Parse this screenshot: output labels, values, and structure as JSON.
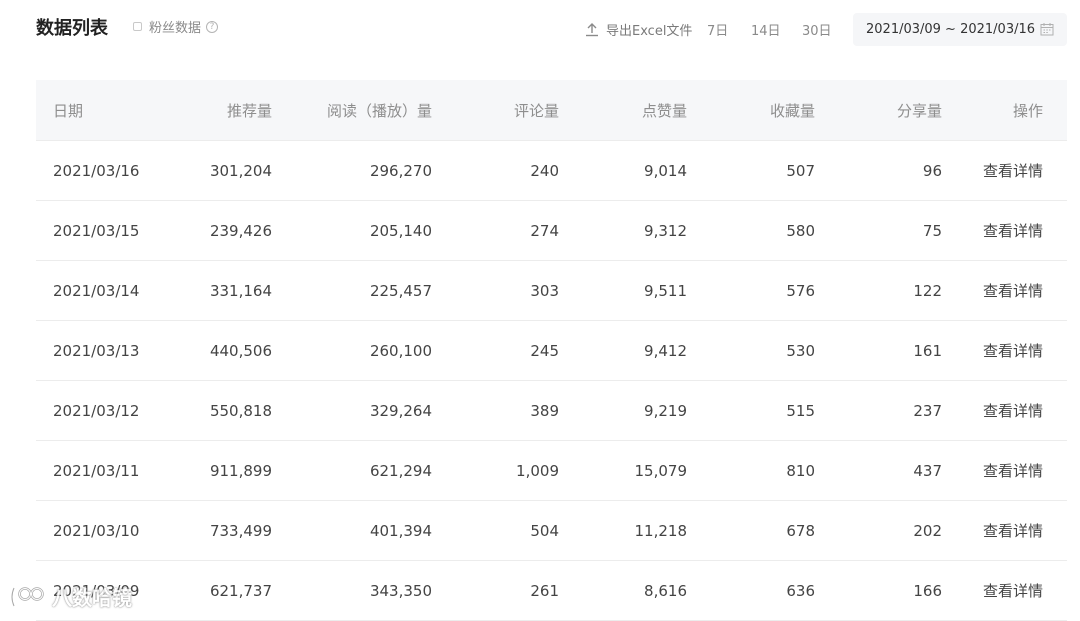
{
  "header": {
    "title": "数据列表",
    "fans_toggle_label": "粉丝数据",
    "help_symbol": "?",
    "export_label": "导出Excel文件",
    "ranges": [
      "7日",
      "14日",
      "30日"
    ],
    "date_range": "2021/03/09 ~ 2021/03/16"
  },
  "table": {
    "columns": [
      "日期",
      "推荐量",
      "阅读（播放）量",
      "评论量",
      "点赞量",
      "收藏量",
      "分享量",
      "操作"
    ],
    "rows": [
      {
        "date": "2021/03/16",
        "recommend": "301,204",
        "read": "296,270",
        "comments": "240",
        "likes": "9,014",
        "favorites": "507",
        "shares": "96",
        "action": "查看详情"
      },
      {
        "date": "2021/03/15",
        "recommend": "239,426",
        "read": "205,140",
        "comments": "274",
        "likes": "9,312",
        "favorites": "580",
        "shares": "75",
        "action": "查看详情"
      },
      {
        "date": "2021/03/14",
        "recommend": "331,164",
        "read": "225,457",
        "comments": "303",
        "likes": "9,511",
        "favorites": "576",
        "shares": "122",
        "action": "查看详情"
      },
      {
        "date": "2021/03/13",
        "recommend": "440,506",
        "read": "260,100",
        "comments": "245",
        "likes": "9,412",
        "favorites": "530",
        "shares": "161",
        "action": "查看详情"
      },
      {
        "date": "2021/03/12",
        "recommend": "550,818",
        "read": "329,264",
        "comments": "389",
        "likes": "9,219",
        "favorites": "515",
        "shares": "237",
        "action": "查看详情"
      },
      {
        "date": "2021/03/11",
        "recommend": "911,899",
        "read": "621,294",
        "comments": "1,009",
        "likes": "15,079",
        "favorites": "810",
        "shares": "437",
        "action": "查看详情"
      },
      {
        "date": "2021/03/10",
        "recommend": "733,499",
        "read": "401,394",
        "comments": "504",
        "likes": "11,218",
        "favorites": "678",
        "shares": "202",
        "action": "查看详情"
      },
      {
        "date": "2021/03/09",
        "recommend": "621,737",
        "read": "343,350",
        "comments": "261",
        "likes": "8,616",
        "favorites": "636",
        "shares": "166",
        "action": "查看详情"
      }
    ]
  },
  "watermark": {
    "text": "八数哈镜",
    "icon": "watermark-logo-icon"
  },
  "icons": {
    "export": "upload-icon",
    "calendar": "calendar-icon",
    "help": "question-circle-icon"
  }
}
